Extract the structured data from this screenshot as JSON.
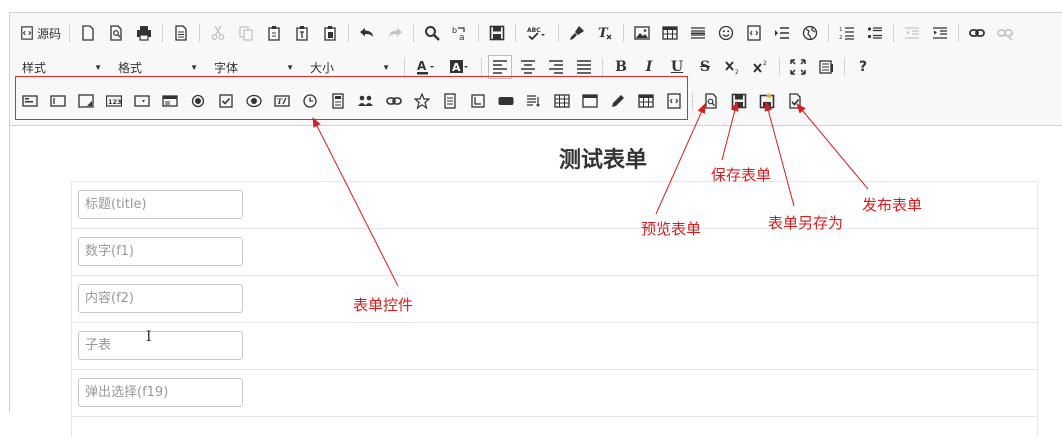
{
  "toolbar": {
    "source_label": "源码",
    "combos": {
      "style": "样式",
      "format": "格式",
      "font": "字体",
      "size": "大小"
    }
  },
  "form": {
    "title": "测试表单",
    "fields": [
      {
        "placeholder": "标题(title)"
      },
      {
        "placeholder": "数字(f1)"
      },
      {
        "placeholder": "内容(f2)"
      },
      {
        "placeholder": "子表"
      },
      {
        "placeholder": "弹出选择(f19)"
      }
    ]
  },
  "annotations": {
    "controls": "表单控件",
    "preview": "预览表单",
    "save": "保存表单",
    "save_as": "表单另存为",
    "publish": "发布表单"
  },
  "colors": {
    "annotation": "#d81e1e",
    "toolbar_bg": "#f8f8f8",
    "border": "#d1d1d1"
  }
}
